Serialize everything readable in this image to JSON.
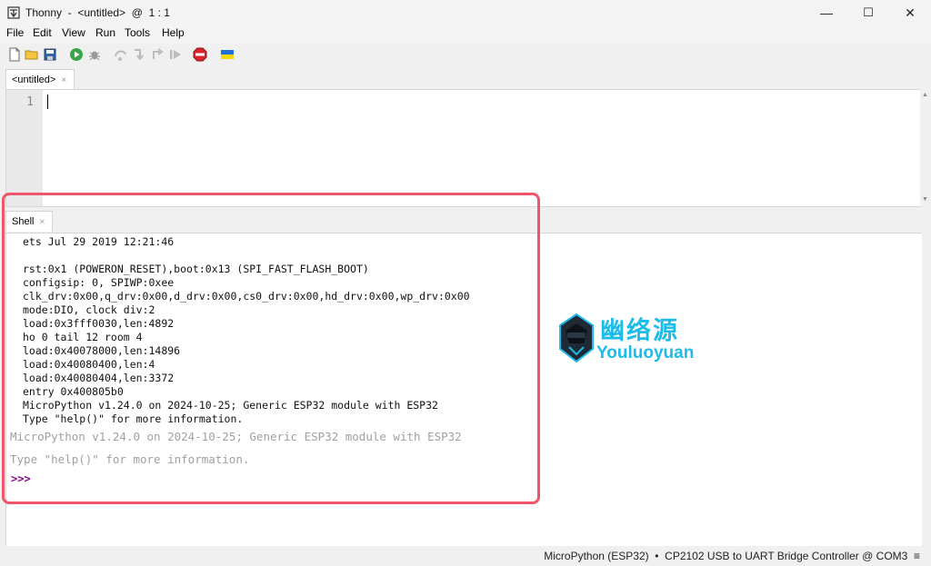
{
  "window": {
    "title": "Thonny  -  <untitled>  @  1 : 1",
    "minimize": "—",
    "maximize": "☐",
    "close": "✕"
  },
  "menu": [
    "File",
    "Edit",
    "View",
    "Run",
    "Tools",
    "Help"
  ],
  "toolbar": {
    "icons": [
      "new-file-icon",
      "open-file-icon",
      "save-icon",
      "run-icon",
      "debug-icon",
      "step-over-icon",
      "step-into-icon",
      "step-out-icon",
      "resume-icon",
      "stop-icon",
      "ukraine-flag-icon"
    ]
  },
  "editor": {
    "tab_label": "<untitled>",
    "close_glyph": "×",
    "line_number": "1"
  },
  "shell": {
    "tab_label": "Shell",
    "close_glyph": "×",
    "output": "ets Jul 29 2019 12:21:46\n\nrst:0x1 (POWERON_RESET),boot:0x13 (SPI_FAST_FLASH_BOOT)\nconfigsip: 0, SPIWP:0xee\nclk_drv:0x00,q_drv:0x00,d_drv:0x00,cs0_drv:0x00,hd_drv:0x00,wp_drv:0x00\nmode:DIO, clock div:2\nload:0x3fff0030,len:4892\nho 0 tail 12 room 4\nload:0x40078000,len:14896\nload:0x40080400,len:4\nload:0x40080404,len:3372\nentry 0x400805b0\nMicroPython v1.24.0 on 2024-10-25; Generic ESP32 module with ESP32\nType \"help()\" for more information.",
    "banner_line1": "MicroPython v1.24.0 on 2024-10-25; Generic ESP32 module with ESP32",
    "banner_line2": "Type \"help()\" for more information.",
    "prompt": ">>>"
  },
  "watermark": {
    "chinese": "幽络源",
    "english": "Youluoyuan"
  },
  "status": {
    "interpreter": "MicroPython (ESP32)  •  CP2102 USB to UART Bridge Controller @ COM3  ≡"
  },
  "colors": {
    "highlight_border": "#f0566a",
    "prompt": "#8a008a",
    "watermark": "#1dbbea"
  }
}
